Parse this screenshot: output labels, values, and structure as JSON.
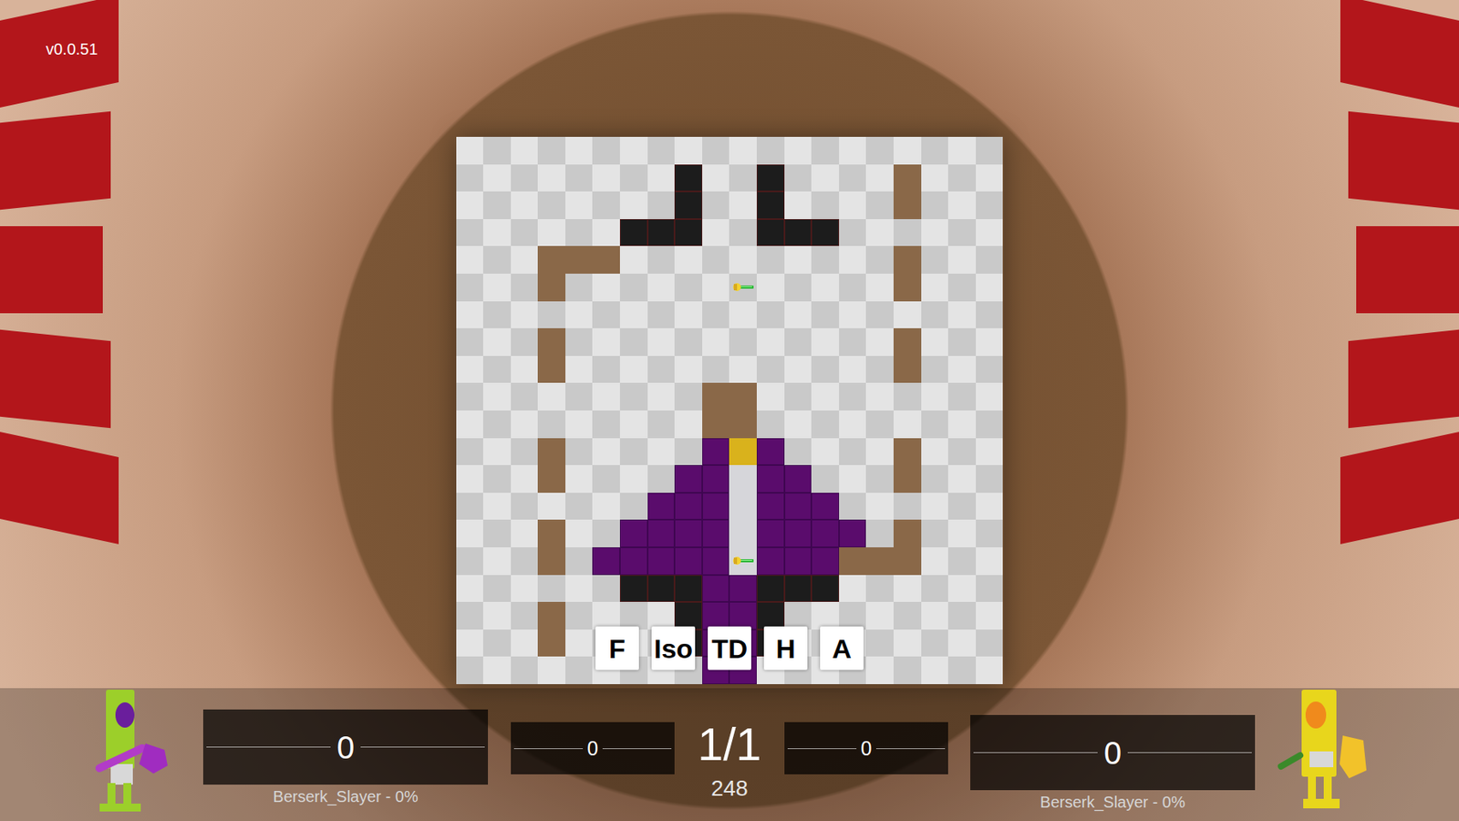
{
  "version": "v0.0.51",
  "view_buttons": [
    {
      "label": "F"
    },
    {
      "label": "Iso"
    },
    {
      "label": "TD"
    },
    {
      "label": "H"
    },
    {
      "label": "A"
    }
  ],
  "board": {
    "rows": [
      "....................",
      "........B..B....W...",
      "........B..B....W...",
      "......BBB..BBB......",
      "...WWW..........W...",
      "...W......a.....W...",
      "....................",
      "...W............W...",
      "...W............W...",
      ".........WW.........",
      ".........WW.........",
      "...W.....PYP....W...",
      "...W....PPLPP...W...",
      ".......PPPLPPP......",
      "...W..PPPPLPPPP.W...",
      "...W.PPPPPbPPPWWW...",
      "......BBBPPBBB......",
      "...W....BPPB........",
      "...W....BPPB........",
      ".........PP........."
    ]
  },
  "hud": {
    "round": "1/1",
    "timer": "248",
    "players": [
      {
        "score": "0",
        "secondary": "0",
        "name": "Berserk_Slayer - 0%",
        "color": "#9ccf2a"
      },
      {
        "score": "0",
        "secondary": "0",
        "name": "Berserk_Slayer - 0%",
        "color": "#e8d61c"
      }
    ]
  }
}
